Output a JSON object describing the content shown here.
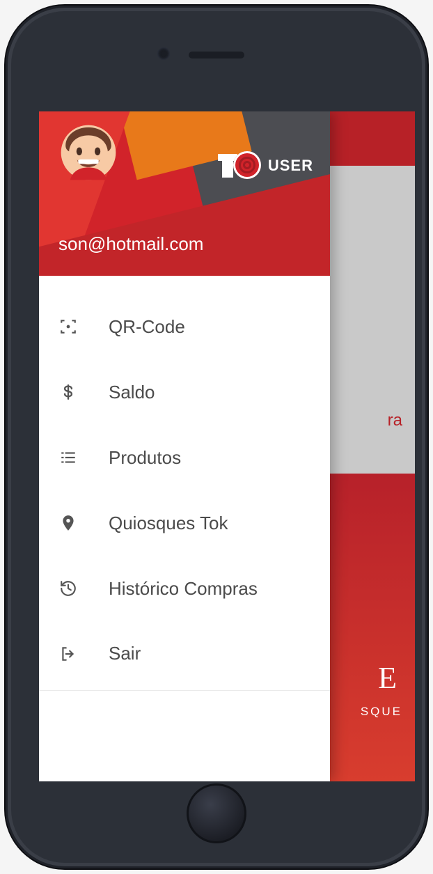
{
  "logo": {
    "brand_suffix": "USER"
  },
  "user": {
    "email": "son@hotmail.com"
  },
  "menu": {
    "qr": {
      "label": "QR-Code",
      "icon": "qr-icon"
    },
    "saldo": {
      "label": "Saldo",
      "icon": "dollar-icon"
    },
    "produtos": {
      "label": "Produtos",
      "icon": "list-icon"
    },
    "quiosques": {
      "label": "Quiosques Tok",
      "icon": "location-icon"
    },
    "historico": {
      "label": "Histórico Compras",
      "icon": "history-icon"
    },
    "sair": {
      "label": "Sair",
      "icon": "logout-icon"
    }
  },
  "background": {
    "hint_partial": "ra",
    "eq_partial": "E",
    "footer_partial": "SQUE"
  }
}
